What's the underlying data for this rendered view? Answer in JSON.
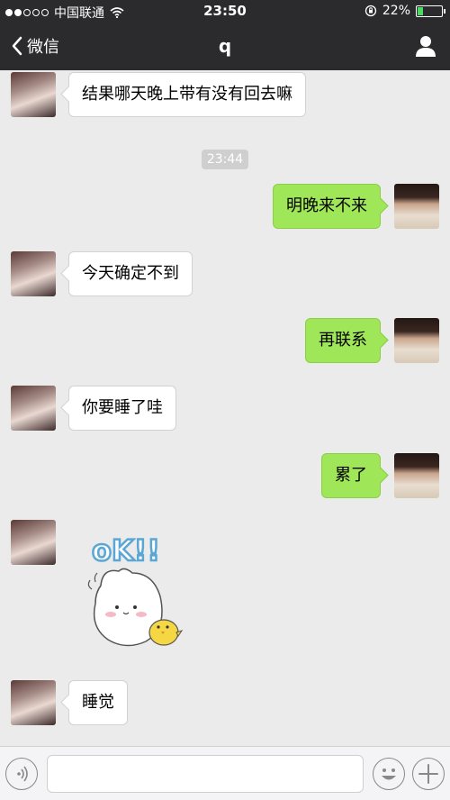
{
  "status_bar": {
    "carrier": "中国联通",
    "time": "23:50",
    "battery_percent": "22%",
    "battery_level": 0.22
  },
  "nav": {
    "back_label": "微信",
    "title": "q"
  },
  "messages": [
    {
      "sender": "contact",
      "text": "结果哪天晚上带有没有回去嘛"
    },
    {
      "sender": "me",
      "text": "明晚来不来"
    },
    {
      "sender": "contact",
      "text": "今天确定不到"
    },
    {
      "sender": "me",
      "text": "再联系"
    },
    {
      "sender": "contact",
      "text": "你要睡了哇"
    },
    {
      "sender": "me",
      "text": "累了"
    },
    {
      "sender": "contact",
      "type": "sticker",
      "sticker_text": "oK!!"
    },
    {
      "sender": "contact",
      "text": "睡觉"
    }
  ],
  "timestamp_chip": "23:44",
  "icons": {
    "back": "chevron-left-icon",
    "profile": "person-icon",
    "voice": "voice-icon",
    "emoji": "smiley-icon",
    "add": "plus-icon",
    "wifi": "wifi-icon",
    "lock": "orientation-lock-icon"
  },
  "colors": {
    "outgoing_bubble": "#9fe658",
    "incoming_bubble": "#ffffff",
    "nav_background": "#2b2b2d",
    "chat_background": "#ebebeb"
  }
}
